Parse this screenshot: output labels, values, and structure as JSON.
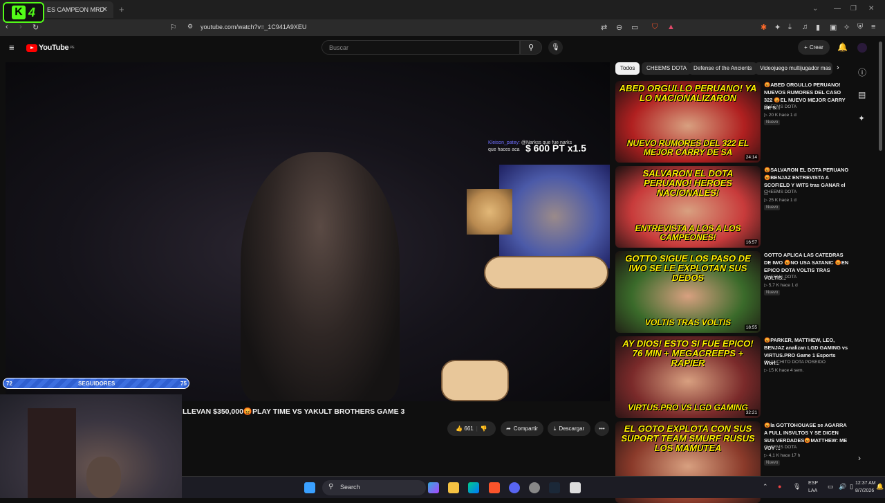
{
  "browser": {
    "tab_title": "ES CAMPEON MRD",
    "tab_close": "✕",
    "new_tab": "+",
    "url": "youtube.com/watch?v=_1C941A9XEU",
    "kick_number": "4"
  },
  "youtube": {
    "logo_text": "YouTube",
    "logo_region": "PE",
    "search_placeholder": "Buscar",
    "create_label": "Crear"
  },
  "video": {
    "chat_user": "Kleison_patey:",
    "chat_text": "@Narkss que fue narks",
    "chat_text2": "que haces aca",
    "points_text": "$ 600 PT x1.5",
    "follow_left": "72",
    "follow_label": "SEGUIDORES",
    "follow_right": "75",
    "follow_progress": 0.96,
    "title": "LLEVAN $350,000😡PLAY TIME VS YAKULT BROTHERS GAME 3",
    "likes": "661",
    "share_label": "Compartir",
    "download_label": "Descargar",
    "more_label": "•••"
  },
  "chips": [
    "Todos",
    "CHEEMS DOTA",
    "Defense of the Ancients",
    "Videojuego multijugador mas"
  ],
  "related": [
    {
      "caption_top": "ABED ORGULLO PERUANO! YA LO NACIONALIZARON",
      "caption_bottom": "NUEVO RUMORES DEL 322 EL MEJOR CARRY DE SA",
      "duration": "24:14",
      "title": "😡ABED ORGULLO PERUANO! NUEVOS RUMORES DEL CASO 322 😡EL NUEVO MEJOR CARRY DE S...",
      "channel": "CHEEMS DOTA",
      "meta": "▷ 20 K  hace 1 d",
      "badge": "Nuevo",
      "color": "#b02020"
    },
    {
      "caption_top": "SALVARON EL DOTA PERUANO! HEROES NACIONALES!",
      "caption_bottom": "ENTREVISTA A LOS A LOS CAMPEONES!",
      "duration": "16:57",
      "title": "😡SALVARON EL DOTA PERUANO 😡BENJAZ ENTREVISTA A SCOFIELD Y WITS tras GANAR el ...",
      "channel": "CHEEMS DOTA",
      "meta": "▷ 25 K  hace 1 d",
      "badge": "Nuevo",
      "color": "#c83b3b"
    },
    {
      "caption_top": "GOTTO SIGUE LOS PASO DE IWO SE LE EXPLOTAN SUS DEDOS",
      "caption_bottom": "VOLTIS TRAS VOLTIS",
      "duration": "18:55",
      "title": "GOTTO APLICA LAS CATEDRAS DE IWO 😡NO USA SATANIC 😡EN EPICO DOTA VOLTIS TRAS VOLTIS...",
      "channel": "CHEEMS DOTA",
      "meta": "▷ 5,7 K  hace 1 d",
      "badge": "Nuevo",
      "color": "#3a6a2a"
    },
    {
      "caption_top": "AY DIOS! ESTO SI FUE EPICO! 76 MIN + MEGACREEPS + RAPIER",
      "caption_bottom": "VIRTUS.PRO VS LGD GAMING",
      "duration": "32:21",
      "title": "😡PARKER, MATTHEW, LEO, BENJAZ analizan LGD GAMING vs VIRTUS.PRO Game 1 Esports Worl...",
      "channel": "CHANCHITO DOTA POSEIDO",
      "meta": "▷ 15 K  hace 4 sem.",
      "badge": "",
      "color": "#7a2a2a"
    },
    {
      "caption_top": "EL GOTO EXPLOTA CON SUS SUPORT TEAM SMURF RUSUS LOS MAMUTEA",
      "caption_bottom": "",
      "duration": "",
      "title": "😡la GOTTOHOUASE se AGARRA A FULL INSVLTOS Y SE DICEN SUS VERDADES😡MATTHEW: ME VOY ...",
      "channel": "CHEEMS DOTA",
      "meta": "▷ 4,1 K  hace 17 h",
      "badge": "Nuevo",
      "color": "#8a3a2a"
    }
  ],
  "taskbar": {
    "search_label": "Search",
    "lang_top": "ESP",
    "lang_bottom": "LAA",
    "time": "12:37 AM",
    "date": "8/7/2026"
  }
}
